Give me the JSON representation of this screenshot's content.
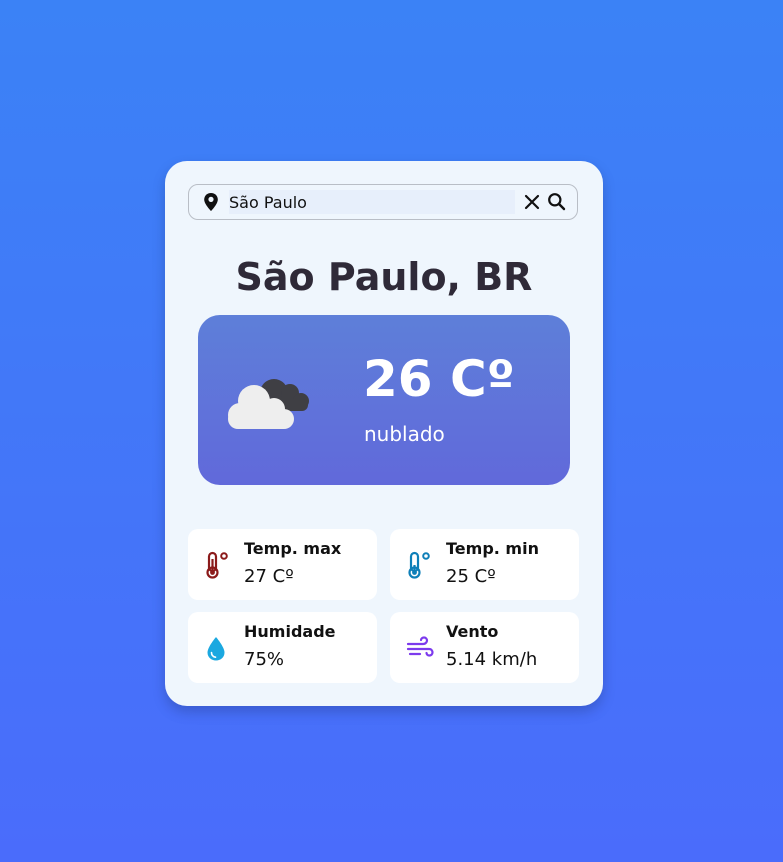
{
  "search": {
    "value": "São Paulo",
    "pin_icon": "map-pin-icon",
    "clear_icon": "close-icon",
    "search_icon": "search-icon"
  },
  "location": {
    "title": "São Paulo, BR"
  },
  "current": {
    "temperature": "26 Cº",
    "condition": "nublado",
    "icon": "cloudy-icon"
  },
  "stats": [
    {
      "label": "Temp. max",
      "value": "27 Cº",
      "icon": "thermometer-hot-icon",
      "color": "#8b1a1a"
    },
    {
      "label": "Temp. min",
      "value": "25 Cº",
      "icon": "thermometer-cold-icon",
      "color": "#0e7fb8"
    },
    {
      "label": "Humidade",
      "value": "75%",
      "icon": "water-drop-icon",
      "color": "#1ba8e0"
    },
    {
      "label": "Vento",
      "value": "5.14 km/h",
      "icon": "wind-icon",
      "color": "#7c3aed"
    }
  ],
  "colors": {
    "background_top": "#3b82f6",
    "background_bottom": "#4a6cfb",
    "card": "#eff6fd",
    "panel_top": "#5e7fd9",
    "panel_bottom": "#6169da",
    "title": "#2f2a38"
  }
}
